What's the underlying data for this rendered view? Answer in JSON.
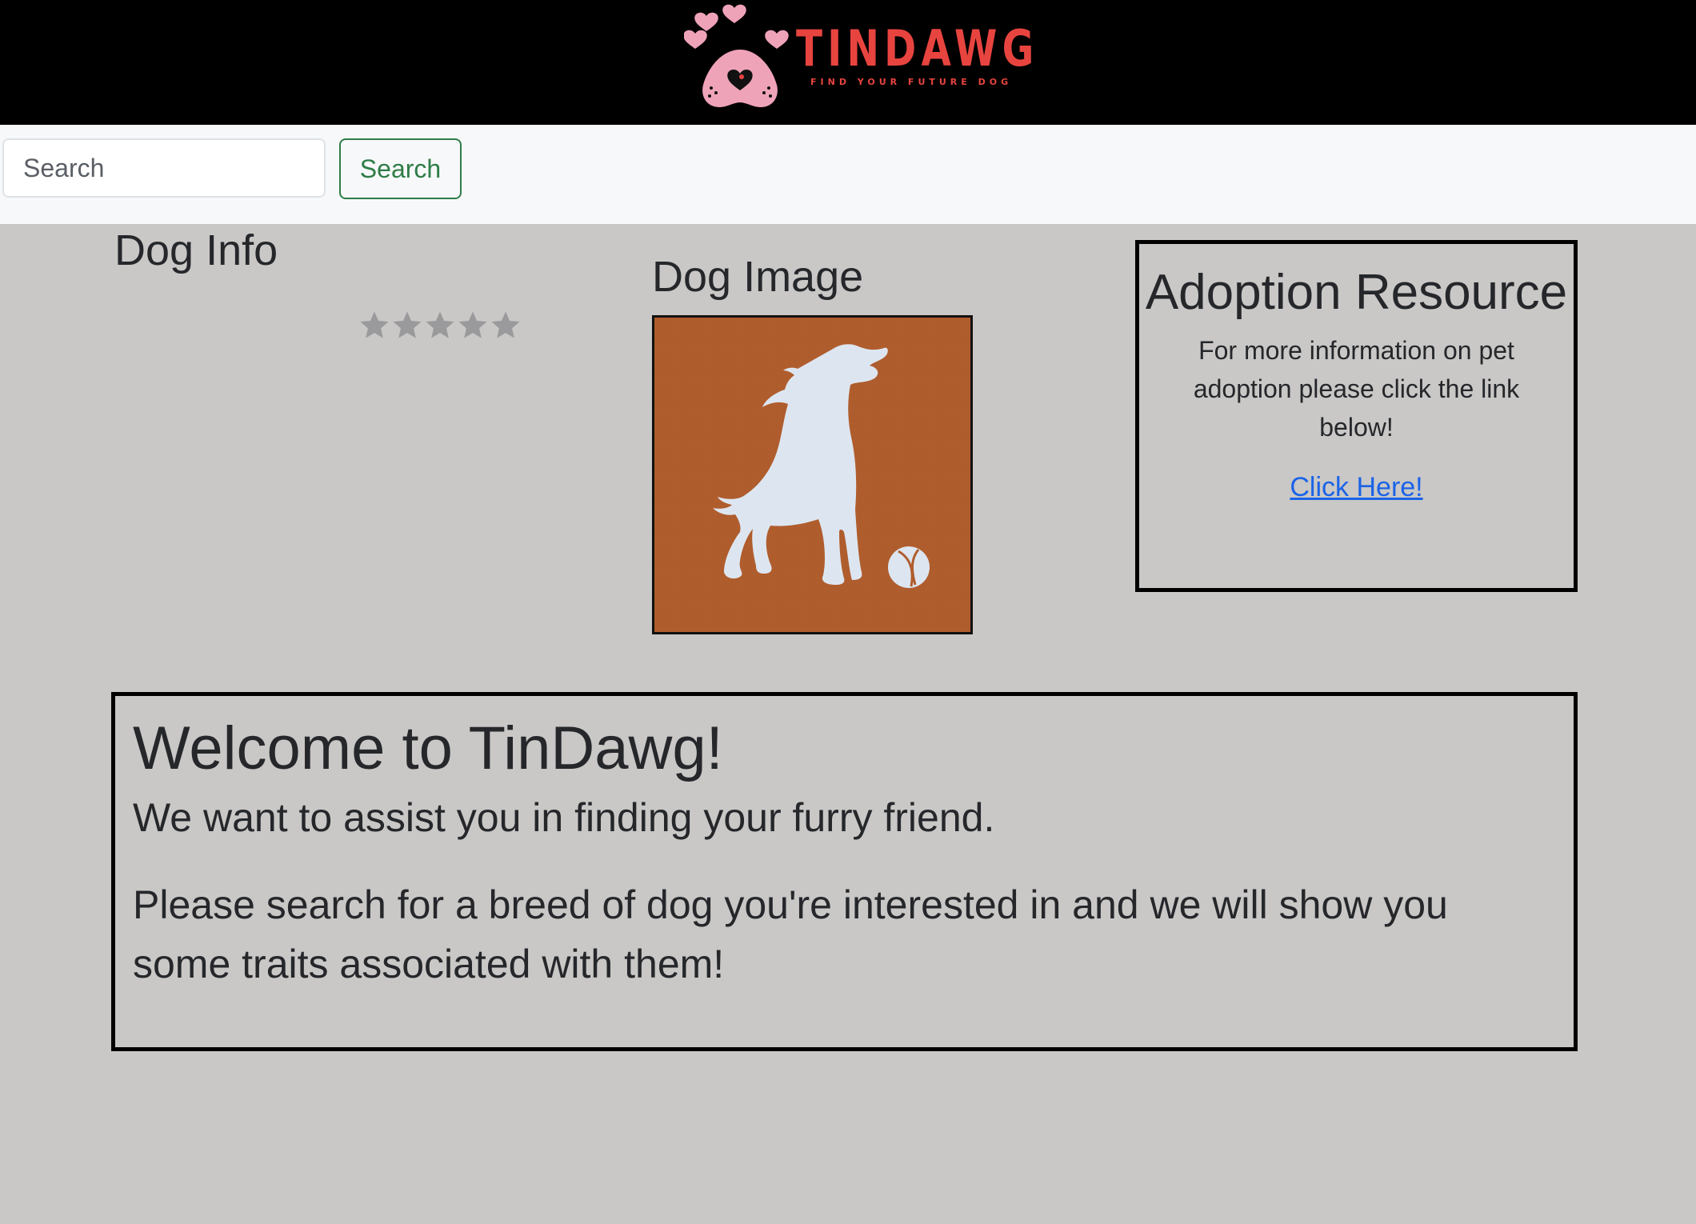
{
  "header": {
    "brand_name": "TINDAWG",
    "tagline": "FIND YOUR FUTURE DOG",
    "colors": {
      "background": "#000000",
      "brand": "#e8443f",
      "logo_pink": "#efa3b9"
    },
    "logo_icon": "paw-heart-icon"
  },
  "search": {
    "placeholder": "Search",
    "value": "",
    "button_label": "Search",
    "button_color": "#2e7d46"
  },
  "dog_info": {
    "title": "Dog Info",
    "rating": {
      "value": 0,
      "max": 5,
      "star_icon": "star-icon",
      "star_color": "#9a9a9c"
    }
  },
  "dog_image": {
    "title": "Dog Image",
    "image_icon": "dog-silhouette-icon",
    "background_color": "#b05d2e",
    "silhouette_color": "#dde6f0"
  },
  "adoption": {
    "title": "Adoption Resource",
    "text": "For more information on pet adoption please click the link below!",
    "link_label": "Click Here!",
    "link_color": "#1b63e8"
  },
  "welcome": {
    "title": "Welcome to TinDawg!",
    "paragraph_1": "We want to assist you in finding your furry friend.",
    "paragraph_2": "Please search for a breed of dog you're interested in and we will show you some traits associated with them!"
  },
  "page": {
    "background_color": "#c9c8c6"
  }
}
